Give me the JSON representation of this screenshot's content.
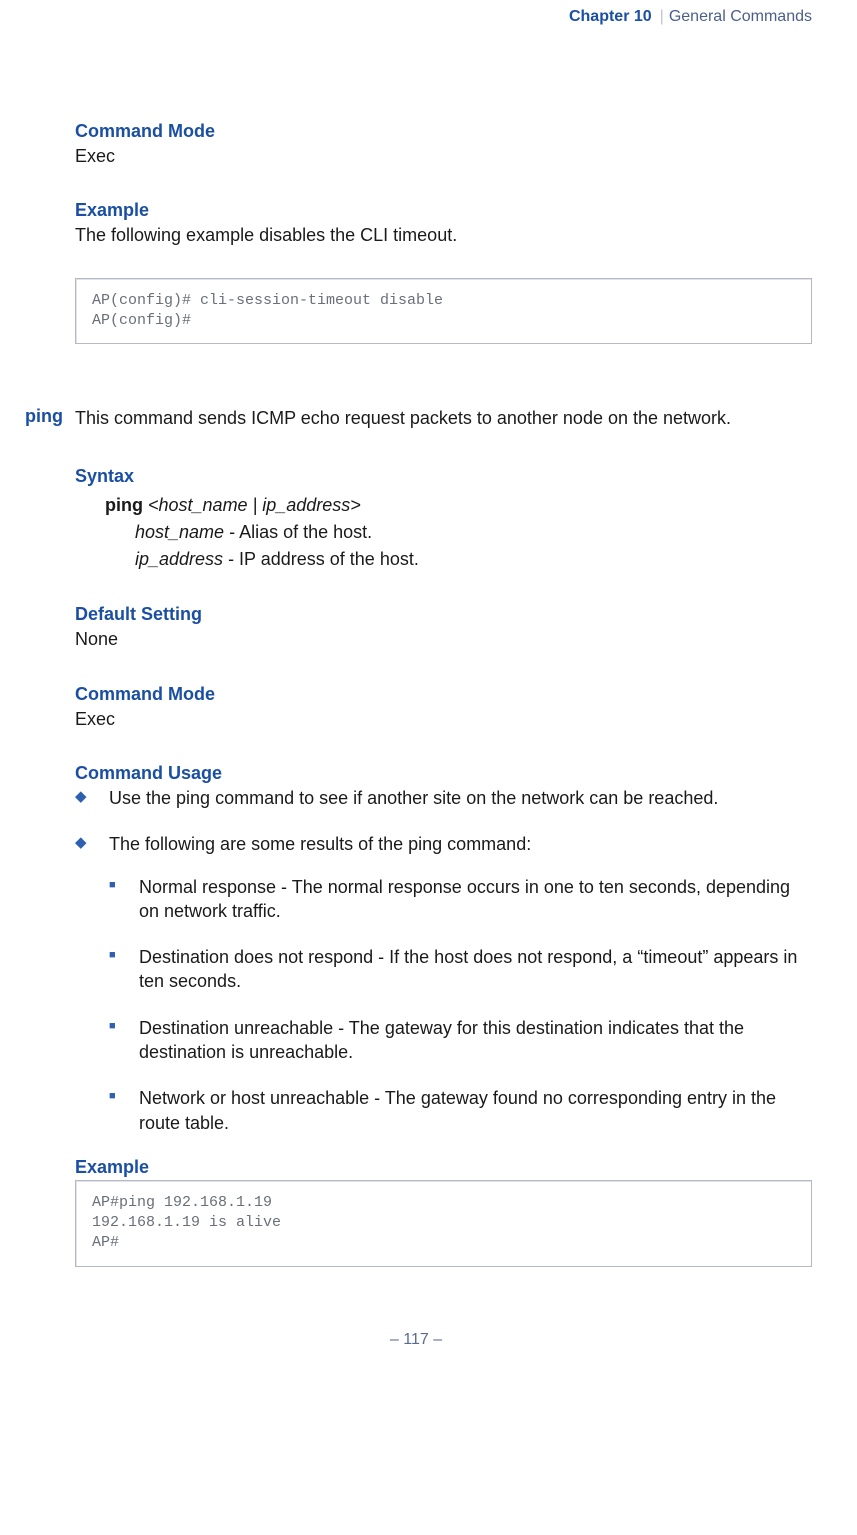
{
  "header": {
    "chapter_label": "Chapter 10",
    "separator": "|",
    "chapter_title": "General Commands"
  },
  "section_top": {
    "command_mode_heading": "Command Mode",
    "command_mode_value": "Exec",
    "example_heading": "Example",
    "example_intro": "The following example disables the CLI timeout.",
    "code": "AP(config)# cli-session-timeout disable\nAP(config)#"
  },
  "ping": {
    "name": "ping",
    "description": "This command sends ICMP echo request packets to another node on the network.",
    "syntax_heading": "Syntax",
    "syntax_cmd": "ping",
    "syntax_args": " <host_name | ip_address>",
    "param_host_name_term": "host_name",
    "param_host_name_desc": " - Alias of the host.",
    "param_ip_term": "ip_address",
    "param_ip_desc": " - IP address of the host.",
    "default_setting_heading": "Default Setting",
    "default_setting_value": "None",
    "command_mode_heading": "Command Mode",
    "command_mode_value": "Exec",
    "command_usage_heading": "Command Usage",
    "usage_items": [
      "Use the ping command to see if another site on the network can be reached.",
      "The following are some results of the ping command:"
    ],
    "usage_sub_items": [
      "Normal response - The normal response occurs in one to ten seconds, depending on network traffic.",
      "Destination does not respond - If the host does not respond, a “timeout” appears in ten seconds.",
      "Destination unreachable - The gateway for this destination indicates that the destination is unreachable.",
      "Network or host unreachable - The gateway found no corresponding entry in the route table."
    ],
    "example_heading": "Example",
    "example_code": "AP#ping 192.168.1.19\n192.168.1.19 is alive\nAP#"
  },
  "footer": {
    "page_number": "–  117  –"
  }
}
